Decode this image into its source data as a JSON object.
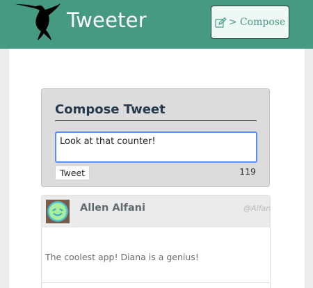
{
  "navbar": {
    "brand": "Tweeter",
    "logo_icon": "hummingbird-icon",
    "compose_button": {
      "icon": "edit-icon",
      "label": "> Compose"
    },
    "background_color": "#479a82"
  },
  "compose": {
    "title": "Compose Tweet",
    "input_value": "Look at that counter!",
    "tweet_button": "Tweet",
    "char_count": "119"
  },
  "tweets": [
    {
      "avatar_icon": "smiley-face-icon",
      "name": "Allen Alfani",
      "handle": "@Alfani",
      "text": "The coolest app! Diana is a genius!"
    }
  ]
}
